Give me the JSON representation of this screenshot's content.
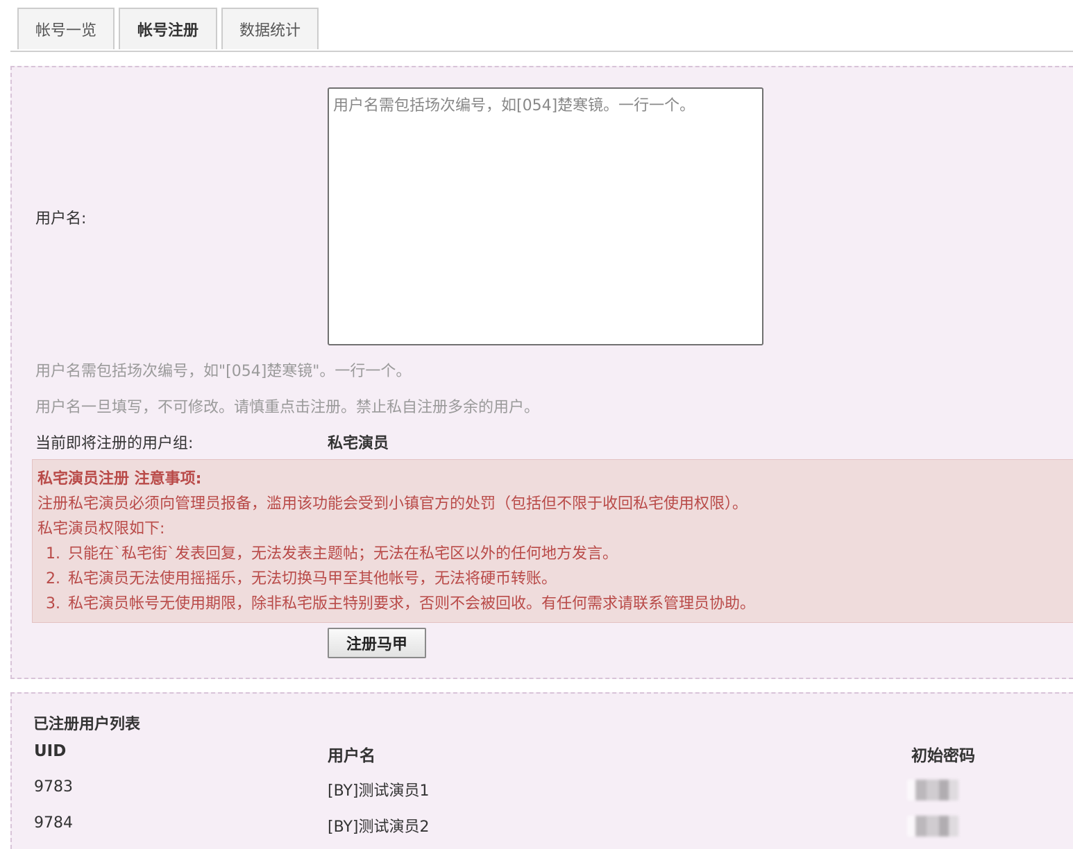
{
  "tabs": [
    {
      "label": "帐号一览"
    },
    {
      "label": "帐号注册"
    },
    {
      "label": "数据统计"
    }
  ],
  "form": {
    "username_label": "用户名:",
    "username_placeholder": "用户名需包括场次编号，如[054]楚寒镜。一行一个。",
    "hint1": "用户名需包括场次编号，如\"[054]楚寒镜\"。一行一个。",
    "hint2": "用户名一旦填写，不可修改。请慎重点击注册。禁止私自注册多余的用户。",
    "group_label": "当前即将注册的用户组:",
    "group_value": "私宅演员",
    "submit_label": "注册马甲"
  },
  "notice": {
    "title": "私宅演员注册 注意事项:",
    "line1": "注册私宅演员必须向管理员报备，滥用该功能会受到小镇官方的处罚（包括但不限于收回私宅使用权限）。",
    "line2": "私宅演员权限如下:",
    "items": [
      "只能在`私宅街`发表回复，无法发表主题帖；无法在私宅区以外的任何地方发言。",
      "私宅演员无法使用摇摇乐，无法切换马甲至其他帐号，无法将硬币转账。",
      "私宅演员帐号无使用期限，除非私宅版主特别要求，否则不会被回收。有任何需求请联系管理员协助。"
    ]
  },
  "user_list": {
    "title": "已注册用户列表",
    "headers": {
      "uid": "UID",
      "username": "用户名",
      "password": "初始密码"
    },
    "rows": [
      {
        "uid": "9783",
        "username": "[BY]测试演员1"
      },
      {
        "uid": "9784",
        "username": "[BY]测试演员2"
      }
    ]
  }
}
